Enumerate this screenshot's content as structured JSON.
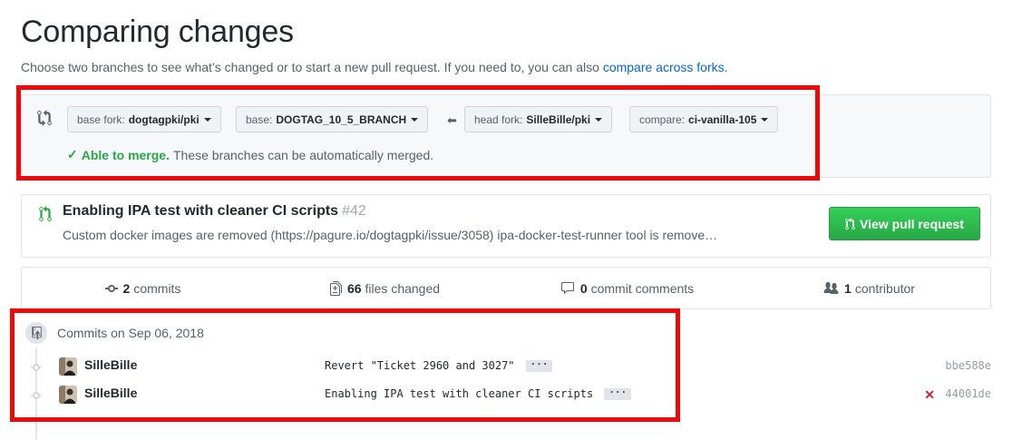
{
  "header": {
    "title": "Comparing changes",
    "subtitle": "Choose two branches to see what’s changed or to start a new pull request. If you need to, you can also",
    "subtitle_link": "compare across forks",
    "subtitle_end": "."
  },
  "compare": {
    "base_fork_label": "base fork:",
    "base_fork_value": "dogtagpki/pki",
    "base_label": "base:",
    "base_value": "DOGTAG_10_5_BRANCH",
    "head_fork_label": "head fork:",
    "head_fork_value": "SilleBille/pki",
    "compare_label": "compare:",
    "compare_value": "ci-vanilla-105",
    "merge_ok": "Able to merge.",
    "merge_text": "These branches can be automatically merged."
  },
  "pull_request": {
    "title": "Enabling IPA test with cleaner CI scripts",
    "number": "#42",
    "description": "Custom docker images are removed (https://pagure.io/dogtagpki/issue/3058) ipa-docker-test-runner tool is remove…",
    "view_button": "View pull request"
  },
  "stats": {
    "commits_count": "2",
    "commits_label": "commits",
    "files_count": "66",
    "files_label": "files changed",
    "comments_count": "0",
    "comments_label": "commit comments",
    "contributors_count": "1",
    "contributors_label": "contributor"
  },
  "commits": {
    "date_heading": "Commits on Sep 06, 2018",
    "items": [
      {
        "author": "SilleBille",
        "message": "Revert \"Ticket 2960 and 3027\"",
        "more": "···",
        "sha": "bbe588e",
        "status": ""
      },
      {
        "author": "SilleBille",
        "message": "Enabling IPA test with cleaner CI scripts",
        "more": "···",
        "sha": "44001de",
        "status": "failed"
      }
    ]
  },
  "colors": {
    "accent_link": "#0366d6",
    "success": "#28a745",
    "fail": "#cb2431",
    "annotation_red": "#ea0a0a"
  }
}
